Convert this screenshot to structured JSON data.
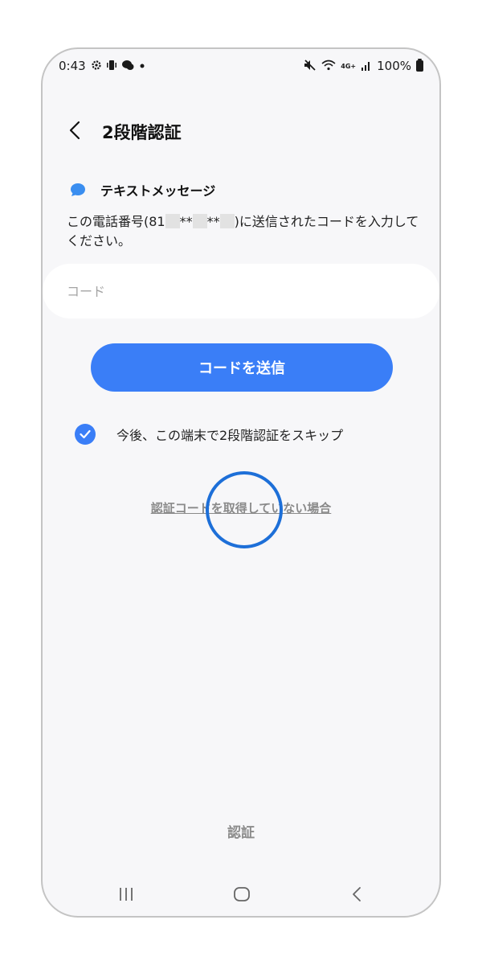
{
  "status_bar": {
    "time": "0:43",
    "network": "4G+",
    "battery": "100%"
  },
  "header": {
    "title": "2段階認証"
  },
  "method": {
    "label": "テキストメッセージ",
    "icon": "chat-bubble-icon"
  },
  "description": {
    "prefix": "この電話番号(81",
    "stars": "**",
    "suffix": ")に送信されたコードを入力してください。"
  },
  "code_input": {
    "placeholder": "コード",
    "value": ""
  },
  "send_button": {
    "label": "コードを送信"
  },
  "skip_option": {
    "label": "今後、この端末で2段階認証をスキップ",
    "checked": true
  },
  "help_link": {
    "label": "認証コードを取得していない場合"
  },
  "verify_button": {
    "label": "認証"
  },
  "colors": {
    "accent": "#3a7ef7",
    "background": "#f7f7f9"
  }
}
